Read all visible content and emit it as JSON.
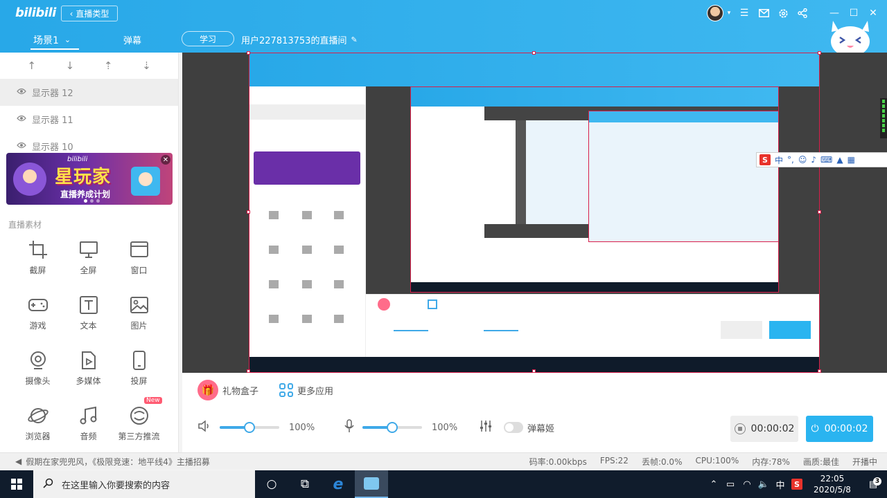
{
  "app": {
    "logo": "bilibili",
    "type_button": "直播类型",
    "scene_tab": "场景1",
    "danmaku_tab": "弹幕",
    "category": "学习",
    "room_title": "用户227813753的直播间"
  },
  "sources": [
    {
      "label": "显示器 12",
      "active": true
    },
    {
      "label": "显示器 11",
      "active": false
    },
    {
      "label": "显示器 10",
      "active": false
    }
  ],
  "banner": {
    "brand": "bilibili",
    "title": "星玩家",
    "subtitle": "直播养成计划",
    "dots": 3
  },
  "materials": {
    "section_label": "直播素材",
    "items": [
      {
        "label": "截屏",
        "icon": "crop-icon"
      },
      {
        "label": "全屏",
        "icon": "monitor-icon"
      },
      {
        "label": "窗口",
        "icon": "window-icon"
      },
      {
        "label": "游戏",
        "icon": "gamepad-icon"
      },
      {
        "label": "文本",
        "icon": "text-icon"
      },
      {
        "label": "图片",
        "icon": "image-icon"
      },
      {
        "label": "摄像头",
        "icon": "webcam-icon"
      },
      {
        "label": "多媒体",
        "icon": "media-file-icon"
      },
      {
        "label": "投屏",
        "icon": "phone-icon"
      },
      {
        "label": "浏览器",
        "icon": "planet-icon"
      },
      {
        "label": "音频",
        "icon": "music-note-icon"
      },
      {
        "label": "第三方推流",
        "icon": "stream-icon",
        "badge": "New"
      }
    ]
  },
  "controls": {
    "gift_box": "礼物盒子",
    "more_apps": "更多应用",
    "speaker_volume": "100%",
    "speaker_level": 0.5,
    "mic_volume": "100%",
    "mic_level": 0.5,
    "danmaku_toggle": "弹幕姬",
    "record_time": "00:00:02",
    "live_time": "00:00:02"
  },
  "statusbar": {
    "notice": "假期在家兜兜风，《极限竞速：地平线4》主播招募",
    "bitrate": "码率:0.00kbps",
    "fps": "FPS:22",
    "dropped": "丢帧:0.0%",
    "cpu": "CPU:100%",
    "memory": "内存:78%",
    "quality": "画质:最佳",
    "mode": "开播中"
  },
  "ime": {
    "logo": "S",
    "mode": "中"
  },
  "taskbar": {
    "search_placeholder": "在这里输入你要搜索的内容",
    "tray_lang": "中",
    "time": "22:05",
    "date": "2020/5/8",
    "notifications": "3"
  },
  "colors": {
    "brand_blue": "#28a8e8",
    "accent": "#3fa9e8",
    "live_button": "#2ab4f0",
    "gift": "#ff6c8a",
    "new_badge": "#ff5b72"
  }
}
